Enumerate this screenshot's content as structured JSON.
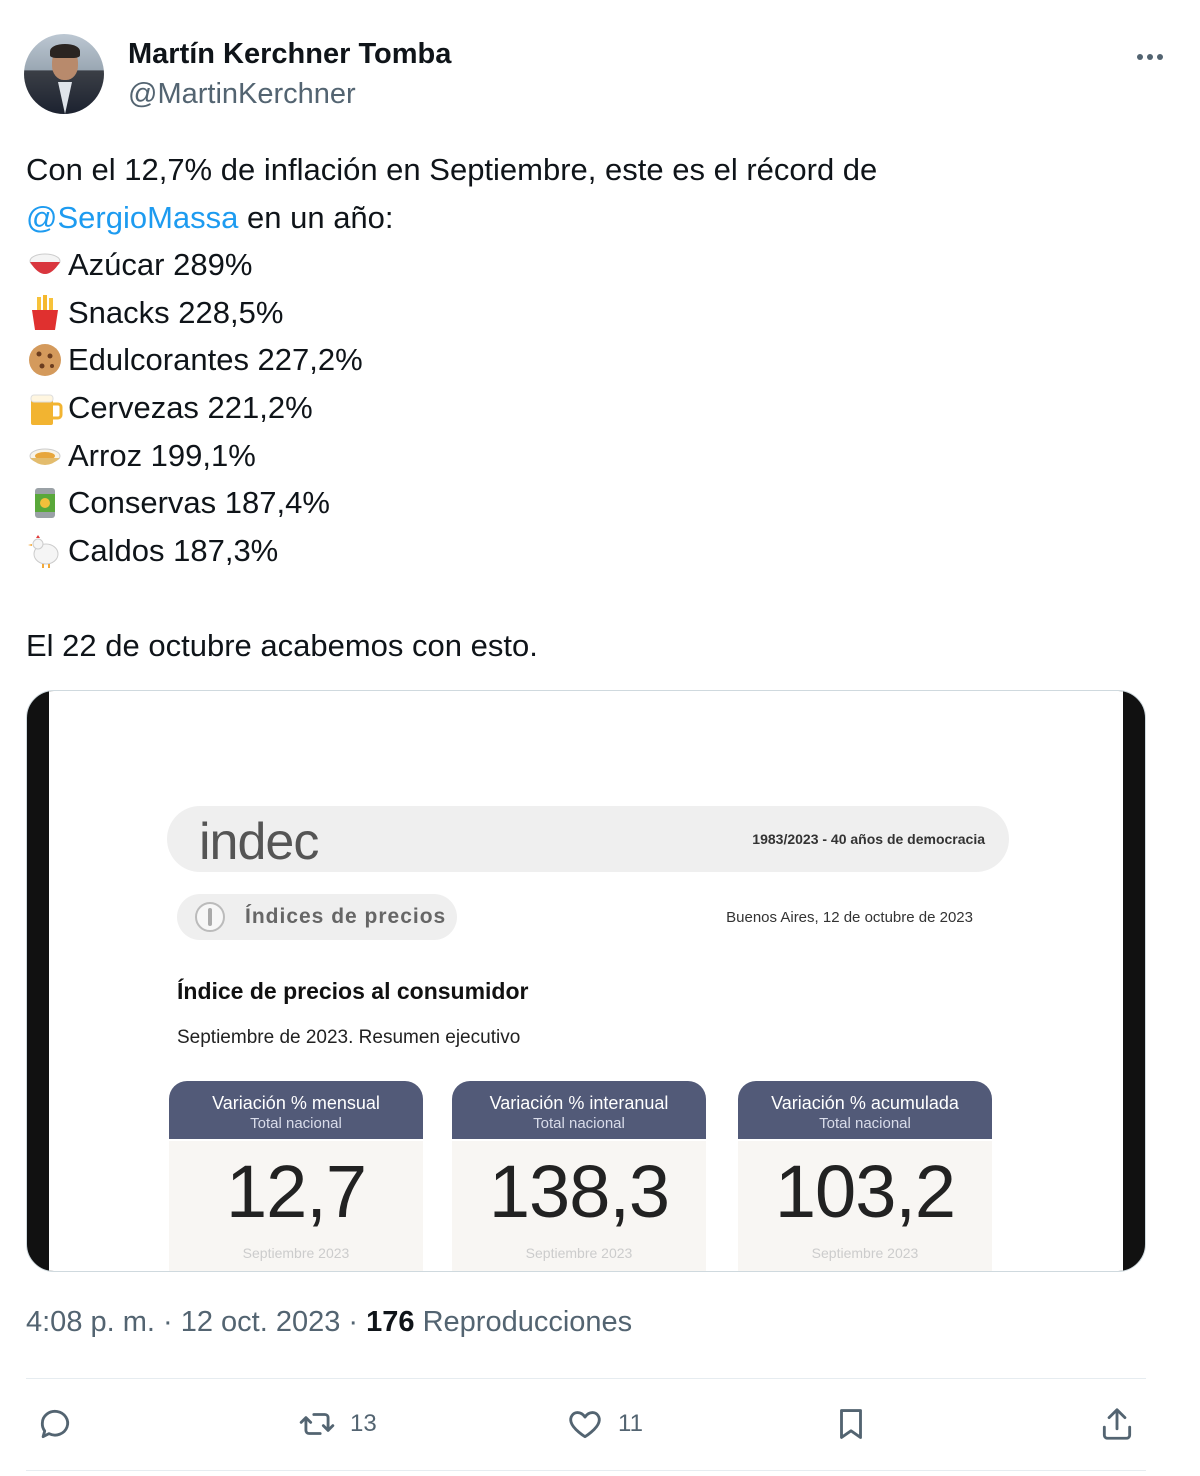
{
  "author": {
    "name": "Martín Kerchner Tomba",
    "handle": "@MartinKerchner"
  },
  "tweet": {
    "intro_1": "Con el 12,7% de inflación en Septiembre, este es el récord de",
    "mention": "@SergioMassa",
    "intro_2": " en un año:",
    "items": [
      {
        "icon": "sugar-bowl-icon",
        "text": "Azúcar 289%"
      },
      {
        "icon": "fries-icon",
        "text": "Snacks 228,5%"
      },
      {
        "icon": "cookie-icon",
        "text": "Edulcorantes 227,2%"
      },
      {
        "icon": "beer-icon",
        "text": "Cervezas 221,2%"
      },
      {
        "icon": "rice-bowl-icon",
        "text": "Arroz 199,1%"
      },
      {
        "icon": "can-icon",
        "text": "Conservas 187,4%"
      },
      {
        "icon": "chicken-icon",
        "text": "Caldos 187,3%"
      }
    ],
    "closing": "El 22 de octubre acabemos con esto."
  },
  "media": {
    "logo": "indec",
    "democracia": "1983/2023 - 40 años de democracia",
    "section": "Índices de precios",
    "date": "Buenos Aires, 12 de octubre de 2023",
    "title": "Índice de precios al consumidor",
    "subtitle": "Septiembre de 2023. Resumen ejecutivo",
    "cards": [
      {
        "head": "Variación % mensual",
        "sub": "Total nacional",
        "value": "12,7",
        "foot": "Septiembre 2023"
      },
      {
        "head": "Variación % interanual",
        "sub": "Total nacional",
        "value": "138,3",
        "foot": "Septiembre 2023"
      },
      {
        "head": "Variación % acumulada",
        "sub": "Total nacional",
        "value": "103,2",
        "foot": "Septiembre 2023"
      }
    ]
  },
  "meta": {
    "time": "4:08 p. m. · 12 oct. 2023 · ",
    "views_count": "176",
    "views_label": " Reproducciones"
  },
  "actions": {
    "reply_count": "",
    "retweet_count": "13",
    "like_count": "11"
  },
  "colors": {
    "mention": "#1d9bf0",
    "secondary_text": "#536471",
    "card_header": "#525a78"
  }
}
